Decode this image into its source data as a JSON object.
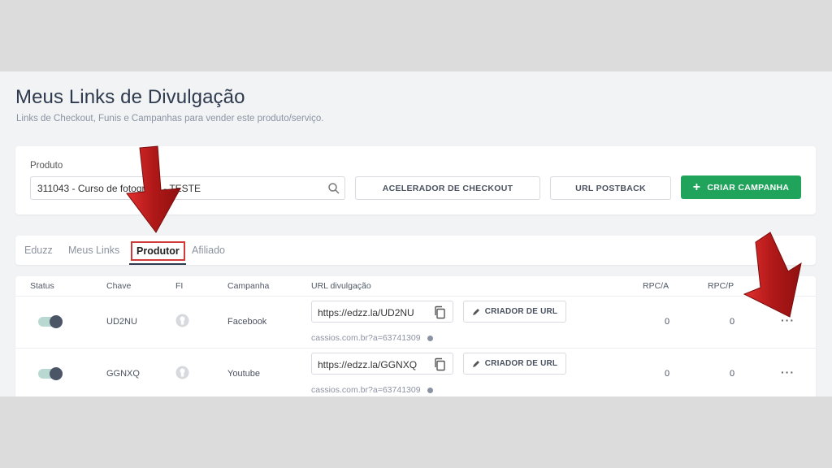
{
  "page": {
    "title": "Meus Links de Divulgação",
    "subtitle": "Links de Checkout, Funis e Campanhas para vender este produto/serviço."
  },
  "product": {
    "label": "Produto",
    "value": "311043 - Curso de fotografia - TESTE"
  },
  "buttons": {
    "acelerador": "ACELERADOR DE CHECKOUT",
    "postback": "URL POSTBACK",
    "criar_campanha": "CRIAR CAMPANHA",
    "criar_plus": "+"
  },
  "tabs": [
    {
      "label": "Eduzz"
    },
    {
      "label": "Meus Links"
    },
    {
      "label": "Produtor"
    },
    {
      "label": "Afiliado"
    }
  ],
  "table": {
    "headers": [
      "Status",
      "Chave",
      "FI",
      "Campanha",
      "URL divulgação",
      "RPC/A",
      "RPC/P"
    ],
    "rows": [
      {
        "chave": "UD2NU",
        "campanha": "Facebook",
        "url": "https://edzz.la/UD2NU",
        "criador_label": "CRIADOR DE URL",
        "affiliate_link": "cassios.com.br?a=63741309",
        "rpc_a": "0",
        "rpc_p": "0",
        "menu": "···"
      },
      {
        "chave": "GGNXQ",
        "campanha": "Youtube",
        "url": "https://edzz.la/GGNXQ",
        "criador_label": "CRIADOR DE URL",
        "affiliate_link": "cassios.com.br?a=63741309",
        "rpc_a": "0",
        "rpc_p": "0",
        "menu": "···"
      }
    ]
  },
  "colors": {
    "accent_green": "#20a35a",
    "highlight_red": "#d13a3a",
    "arrow_red": "#c81e1e"
  },
  "icons": [
    "search-icon",
    "copy-icon",
    "pencil-icon",
    "fi-icon",
    "info-icon",
    "more-icon",
    "arrow-down-icon"
  ]
}
